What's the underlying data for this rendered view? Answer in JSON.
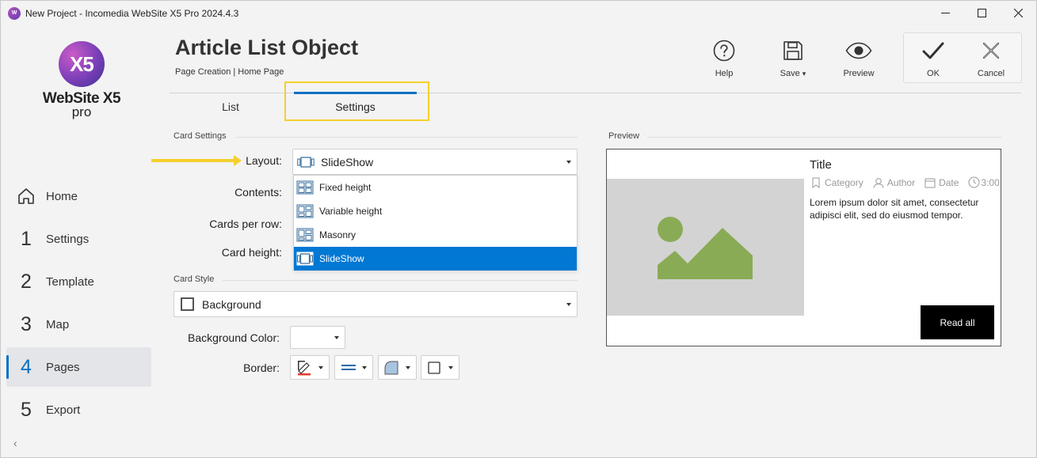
{
  "window": {
    "title": "New Project - Incomedia WebSite X5 Pro 2024.4.3",
    "minimize_label": "—",
    "maximize_label": "☐",
    "close_label": "✕"
  },
  "logo": {
    "mark": "X5",
    "name": "WebSite X5",
    "edition": "pro"
  },
  "nav": {
    "items": [
      {
        "num": "",
        "label": "Home"
      },
      {
        "num": "1",
        "label": "Settings"
      },
      {
        "num": "2",
        "label": "Template"
      },
      {
        "num": "3",
        "label": "Map"
      },
      {
        "num": "4",
        "label": "Pages"
      },
      {
        "num": "5",
        "label": "Export"
      }
    ],
    "collapse_label": "‹"
  },
  "header": {
    "title": "Article List Object",
    "breadcrumb": "Page Creation | Home Page"
  },
  "toolbar": {
    "help": "Help",
    "save": "Save",
    "save_caret": "▾",
    "preview": "Preview",
    "ok": "OK",
    "cancel": "Cancel"
  },
  "tabs": {
    "list": "List",
    "settings": "Settings"
  },
  "card_settings": {
    "section": "Card Settings",
    "layout_label": "Layout:",
    "layout_value": "SlideShow",
    "contents_label": "Contents:",
    "cards_per_row_label": "Cards per row:",
    "card_height_label": "Card height:",
    "layout_options": [
      "Fixed height",
      "Variable height",
      "Masonry",
      "SlideShow"
    ]
  },
  "card_style": {
    "section": "Card Style",
    "style_value": "Background",
    "bg_color_label": "Background Color:",
    "border_label": "Border:"
  },
  "preview": {
    "section": "Preview",
    "title": "Title",
    "category": "Category",
    "author": "Author",
    "date": "Date",
    "time": "3:00",
    "body": "Lorem ipsum dolor sit amet, consectetur adipisci elit, sed do eiusmod tempor.",
    "read_all": "Read all"
  },
  "colors": {
    "accent": "#0a6fc2",
    "selection": "#0078d4",
    "highlight": "#f4d02c",
    "image_green": "#8aab55",
    "image_bg": "#d3d3d3"
  }
}
